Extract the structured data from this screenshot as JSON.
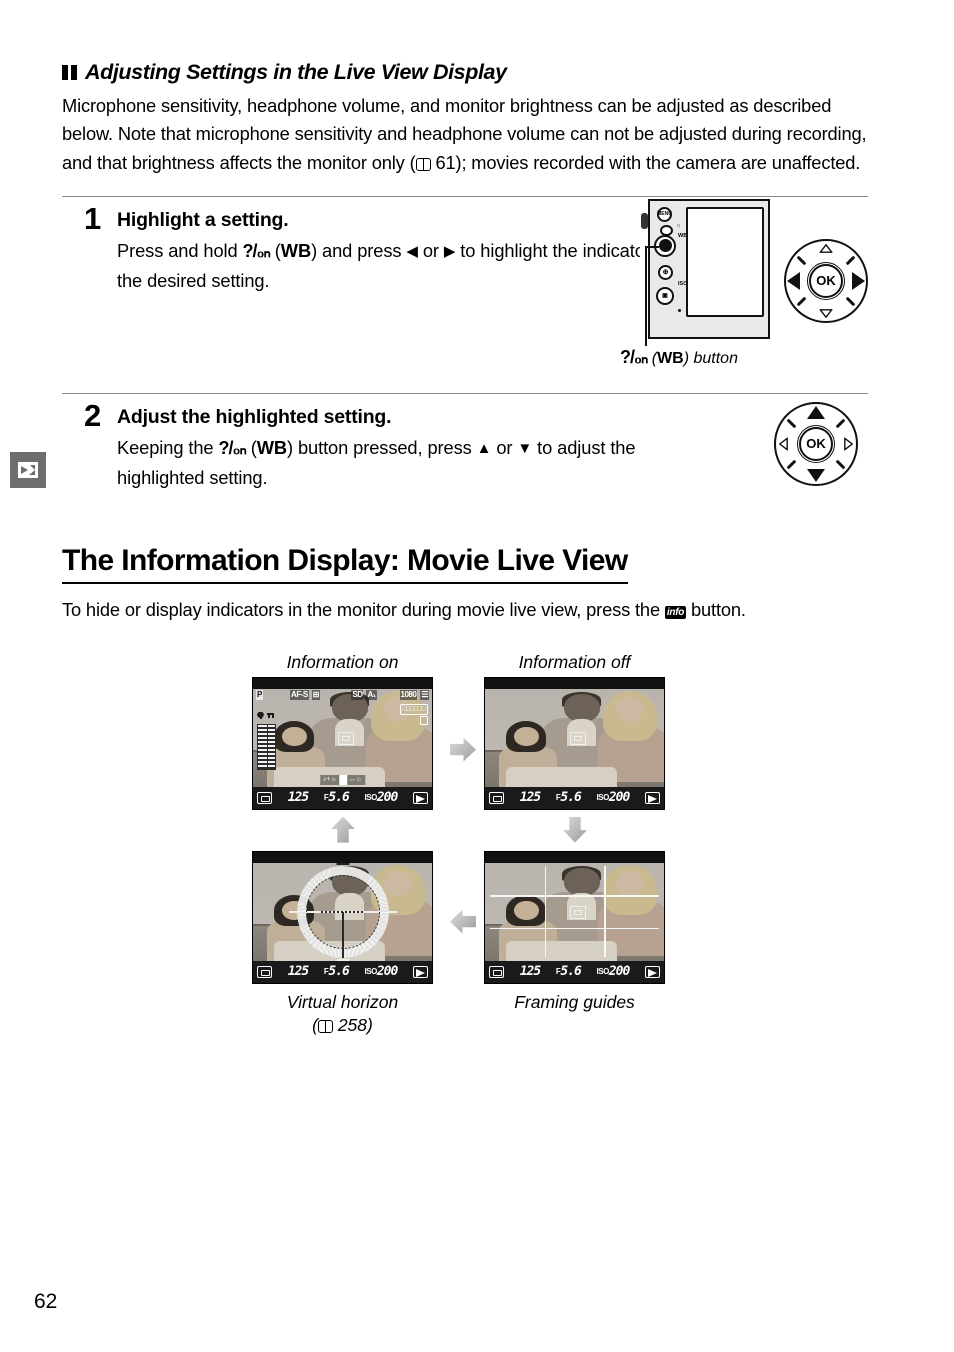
{
  "page": {
    "number": "62",
    "margin_tab_icon": "movie-camera-icon"
  },
  "section": {
    "heading": "Adjusting Settings in the Live View Display",
    "intro_part1": "Microphone sensitivity, headphone volume, and monitor brightness can be adjusted as described below.  Note that microphone sensitivity and headphone volume can not be adjusted during recording, and that brightness affects the monitor only (",
    "intro_ref": "61",
    "intro_part2": "); movies recorded with the camera are unaffected."
  },
  "steps": [
    {
      "number": "1",
      "title": "Highlight a setting.",
      "text_a": "Press and hold ",
      "glyph": "?/₀ₙ",
      "text_b": " (",
      "wb": "WB",
      "text_c": ") and press ",
      "left_arrow": "◀",
      "text_d": " or ",
      "right_arrow": "▶",
      "text_e": " to highlight the indicator for the desired setting.",
      "art_caption_glyph": "?/₀ₙ",
      "art_caption_wb": "WB",
      "art_caption_rest": ") button",
      "camera_buttons": [
        "MENU",
        "WB",
        "ISO"
      ]
    },
    {
      "number": "2",
      "title": "Adjust the highlighted setting.",
      "text_a": "Keeping the ",
      "glyph": "?/₀ₙ",
      "text_b": " (",
      "wb": "WB",
      "text_c": ") button pressed, press ",
      "up_arrow": "▲",
      "text_d": " or ",
      "down_arrow": "▼",
      "text_e": " to adjust the highlighted setting."
    }
  ],
  "main": {
    "heading": "The Information Display: Movie Live View",
    "body_a": "To hide or display indicators in the monitor during movie live view, press the ",
    "info_icon_label": "info",
    "body_b": " button."
  },
  "figure": {
    "labels": {
      "info_on": "Information on",
      "info_off": "Information off",
      "virtual_horizon": "Virtual horizon",
      "virtual_horizon_ref": "258",
      "framing_guides": "Framing guides"
    },
    "monitor_osd": {
      "mode": "P",
      "focus_mode": "AF-S",
      "af_area": "⊞",
      "image_area": "SD",
      "quality": "A₁",
      "frame_size": "1080",
      "top_right": "☰",
      "rec_time": "□□□□□□",
      "shutter": "125",
      "aperture_prefix": "F",
      "aperture": "5.6",
      "iso_label": "ISO",
      "iso": "200",
      "metering_icon": "matrix-metering-icon",
      "movie_icon": "movie-mode-icon",
      "mic_icon": "microphone-icon",
      "headphone_icon": "headphone-icon",
      "brightness_icon": "brightness-icon"
    },
    "arrows": [
      "right",
      "down",
      "left",
      "up"
    ]
  },
  "colors": {
    "tab_gray": "#6e6e6e",
    "rule_gray": "#8a8a8a",
    "osd_black": "#1a1a1a",
    "arrow_light": "#dddddd",
    "arrow_dark": "#9a9a9a"
  }
}
